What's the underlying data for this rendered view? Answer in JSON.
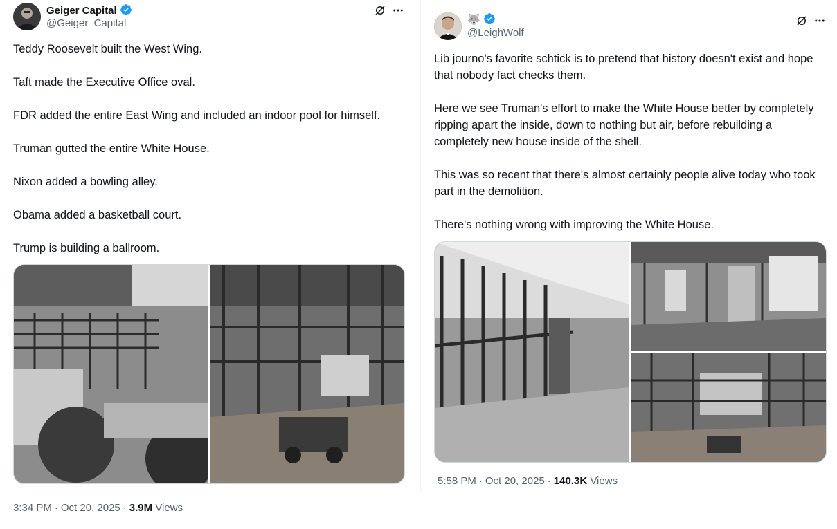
{
  "left_tweet": {
    "author": {
      "name": "Geiger Capital",
      "handle": "@Geiger_Capital",
      "verified_icon": "verified-badge-icon"
    },
    "paragraphs": [
      "Teddy Roosevelt built the West Wing.",
      "Taft made the Executive Office oval.",
      "FDR added the entire East Wing and included an indoor pool for himself.",
      "Truman gutted the entire White House.",
      "Nixon added a bowling alley.",
      "Obama added a basketball court.",
      "Trump is building a ballroom."
    ],
    "meta": {
      "time": "3:34 PM",
      "date": "Oct 20, 2025",
      "views_count": "3.9M",
      "views_label": "Views",
      "separator": "·"
    }
  },
  "right_tweet": {
    "author": {
      "name": "🐺",
      "handle": "@LeighWolf",
      "verified_icon": "verified-badge-icon"
    },
    "paragraphs": [
      "Lib journo's favorite schtick is to pretend that history doesn't exist and hope that nobody fact checks them.",
      "Here we see Truman's effort to make the White House better by completely ripping apart the inside, down to nothing but air, before rebuilding a completely new house inside of the shell.",
      "This was so recent that there's almost certainly people alive today who took part in the demolition.",
      "There's nothing wrong with improving the White House."
    ],
    "meta": {
      "time": "5:58 PM",
      "date": "Oct 20, 2025",
      "views_count": "140.3K",
      "views_label": "Views",
      "separator": "·"
    }
  },
  "colors": {
    "text": "#0f1419",
    "secondary": "#536471",
    "verified": "#1d9bf0",
    "border": "#cfd9de"
  },
  "icons": {
    "grok": "grok-icon",
    "more": "more-icon"
  }
}
